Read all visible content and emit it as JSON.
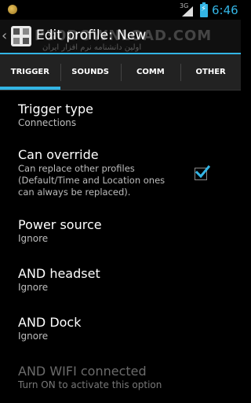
{
  "status_bar": {
    "network_type": "3G",
    "time": "6:46",
    "icons": [
      "notification-icon",
      "signal-icon",
      "battery-charging-icon"
    ]
  },
  "action_bar": {
    "title": "Edit profile: New",
    "watermark": "P30DOWNLOAD.COM",
    "watermark_subtitle": "اولین دانشنامه نرم افزار ایران"
  },
  "tabs": [
    {
      "label": "TRIGGER",
      "active": true
    },
    {
      "label": "SOUNDS",
      "active": false
    },
    {
      "label": "COMM",
      "active": false
    },
    {
      "label": "OTHER",
      "active": false
    }
  ],
  "settings": [
    {
      "title": "Trigger type",
      "summary": "Connections",
      "enabled": true
    },
    {
      "title": "Can override",
      "summary": "Can replace other profiles (Default/Time and Location ones can always be replaced).",
      "checked": true,
      "enabled": true
    },
    {
      "title": "Power source",
      "summary": "Ignore",
      "enabled": true
    },
    {
      "title": "AND headset",
      "summary": "Ignore",
      "enabled": true
    },
    {
      "title": "AND Dock",
      "summary": "Ignore",
      "enabled": true
    },
    {
      "title": "AND WIFI connected",
      "summary": "Turn ON to activate this option",
      "enabled": false
    }
  ],
  "colors": {
    "accent": "#33b5e5",
    "background": "#000000",
    "tab_bar": "#222222",
    "disabled_text": "#6b6b6b"
  }
}
